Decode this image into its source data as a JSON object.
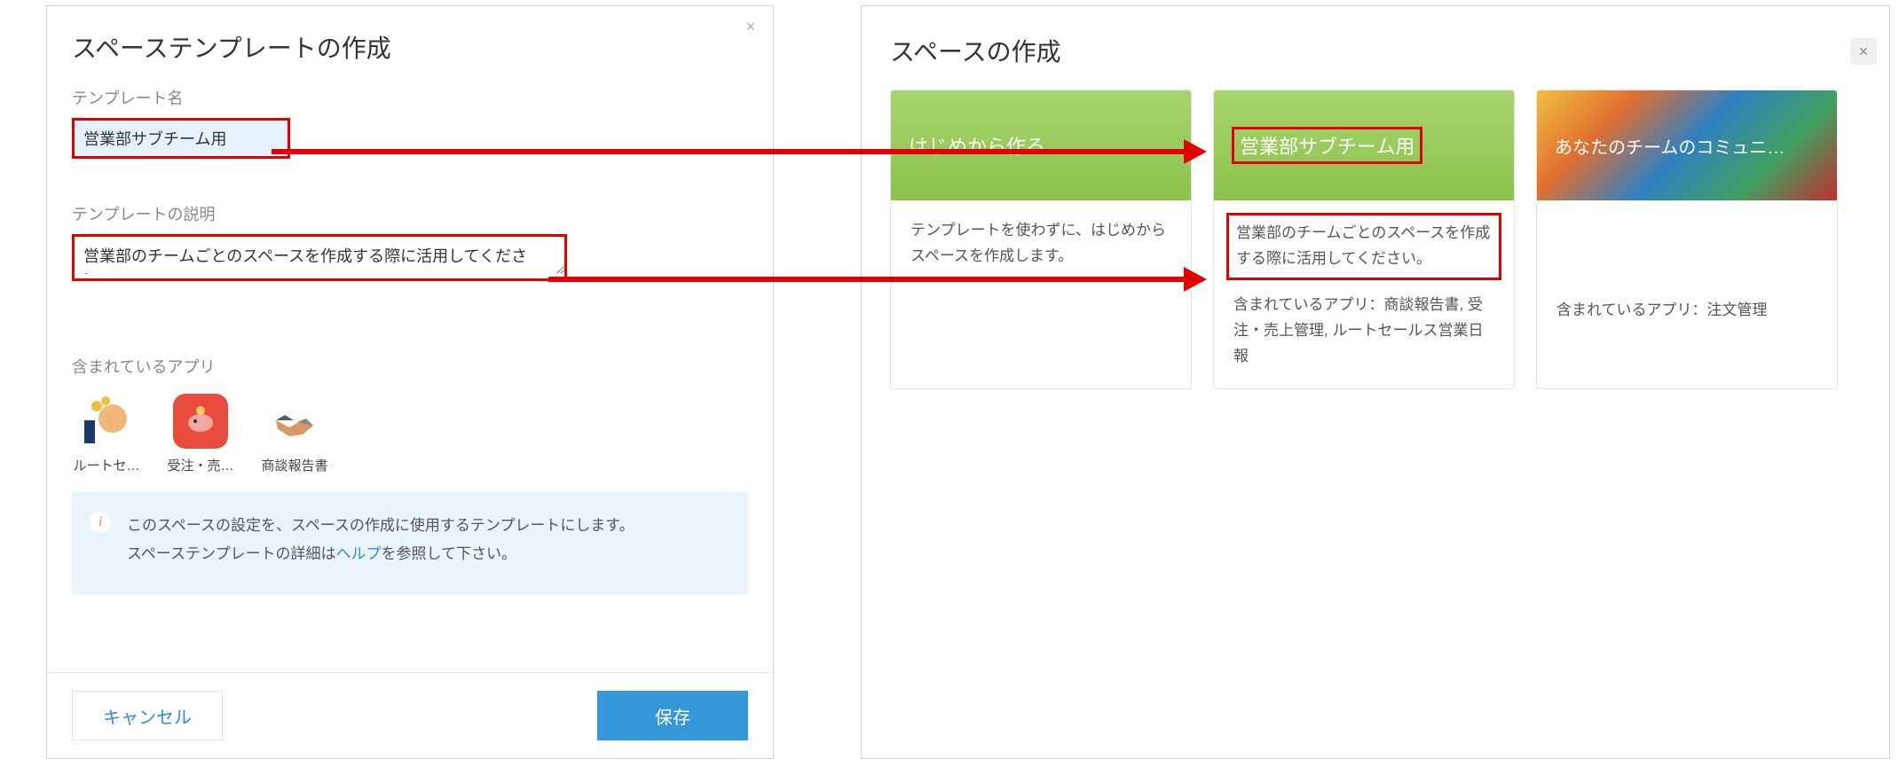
{
  "left": {
    "title": "スペーステンプレートの作成",
    "name_label": "テンプレート名",
    "name_value": "営業部サブチーム用",
    "desc_label": "テンプレートの説明",
    "desc_value": "営業部のチームごとのスペースを作成する際に活用してください。",
    "apps_label": "含まれているアプリ",
    "apps": [
      {
        "label": "ルートセ…"
      },
      {
        "label": "受注・売…"
      },
      {
        "label": "商談報告書"
      }
    ],
    "info_line1": "このスペースの設定を、スペースの作成に使用するテンプレートにします。",
    "info_line2_a": "スペーステンプレートの詳細は",
    "info_link": "ヘルプ",
    "info_line2_b": "を参照して下さい。",
    "cancel": "キャンセル",
    "save": "保存"
  },
  "right": {
    "title": "スペースの作成",
    "cards": [
      {
        "header": "はじめから作る",
        "desc": "テンプレートを使わずに、はじめからスペースを作成します。",
        "apps": ""
      },
      {
        "header": "営業部サブチーム用",
        "desc": "営業部のチームごとのスペースを作成する際に活用してください。",
        "apps": "含まれているアプリ：商談報告書, 受注・売上管理, ルートセールス営業日報"
      },
      {
        "header": "あなたのチームのコミュニ…",
        "desc": "",
        "apps": "含まれているアプリ：注文管理"
      }
    ]
  }
}
